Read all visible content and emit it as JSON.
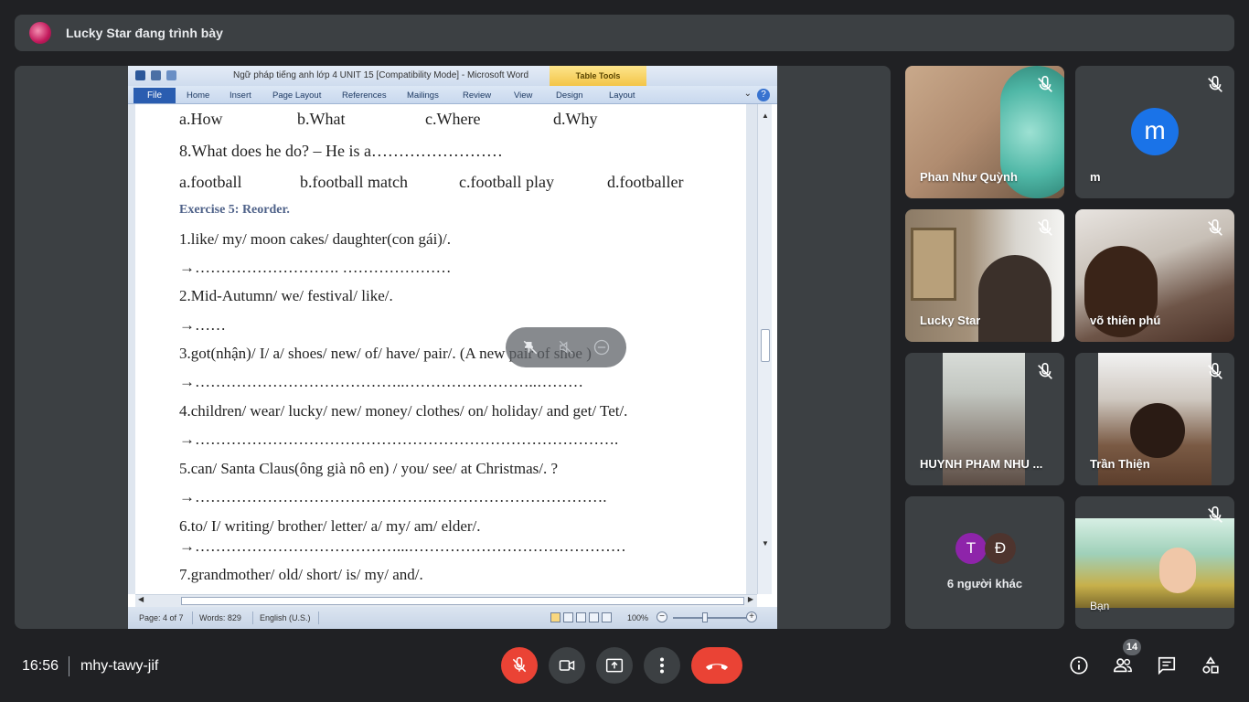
{
  "banner": {
    "presenter_text": "Lucky Star đang trình bày"
  },
  "word": {
    "title": "Ngữ pháp tiếng anh lớp 4  UNIT 15 [Compatibility Mode]  -  Microsoft Word",
    "table_tools": "Table Tools",
    "file_tab": "File",
    "tabs": [
      "Home",
      "Insert",
      "Page Layout",
      "References",
      "Mailings",
      "Review",
      "View",
      "Design",
      "Layout"
    ],
    "doc": {
      "q7_options": [
        "a.How",
        "b.What",
        "c.Where",
        "d.Why"
      ],
      "q8": "8.What does he do? – He is a……………………",
      "q8_options": [
        "a.football",
        "b.football match",
        "c.football play",
        "d.footballer"
      ],
      "exercise_title": "Exercise 5: Reorder.",
      "lines": [
        "1.like/ my/ moon cakes/ daughter(con gái)/.",
        "→………………………. …………………",
        "2.Mid-Autumn/ we/ festival/ like/.",
        "→……",
        "3.got(nhận)/ I/ a/ shoes/ new/ of/ have/ pair/. (A new pair of shoe   )",
        "→…………………………………..……………………..………",
        "4.children/ wear/ lucky/ new/ money/ clothes/ on/ holiday/ and get/ Tet/.",
        "→……………………………………………………………………….",
        "5.can/ Santa Claus(ông già nô en) / you/ see/ at Christmas/. ?",
        "→……………………………………….…………………………….",
        "6.to/ I/ writing/ brother/ letter/ a/ my/ am/ elder/.",
        "→…………………………………...……………………………………",
        "7.grandmother/ old/ short/ is/ my/ and/."
      ]
    },
    "status": {
      "page": "Page: 4 of 7",
      "words": "Words: 829",
      "language": "English (U.S.)",
      "zoom": "100%"
    }
  },
  "participants": [
    {
      "name": "Phan Như Quỳnh",
      "muted": true
    },
    {
      "name": "m",
      "avatar_letter": "m",
      "avatar_color": "#1a73e8",
      "muted": true
    },
    {
      "name": "Lucky Star",
      "muted": true
    },
    {
      "name": "võ thiên phú",
      "muted": true
    },
    {
      "name": "HUYNH PHAM NHU ...",
      "muted": true
    },
    {
      "name": "Trần Thiện",
      "muted": true
    },
    {
      "name": "6 người khác",
      "avatars": [
        "T",
        "Đ"
      ],
      "avatar_colors": [
        "#8e24aa",
        "#4e342e"
      ]
    },
    {
      "name": "Bạn",
      "muted": true
    }
  ],
  "bottom": {
    "time": "16:56",
    "meeting_code": "mhy-tawy-jif",
    "people_count": "14"
  },
  "colors": {
    "danger": "#ea4335",
    "surface": "#3c4043",
    "background": "#202124"
  }
}
